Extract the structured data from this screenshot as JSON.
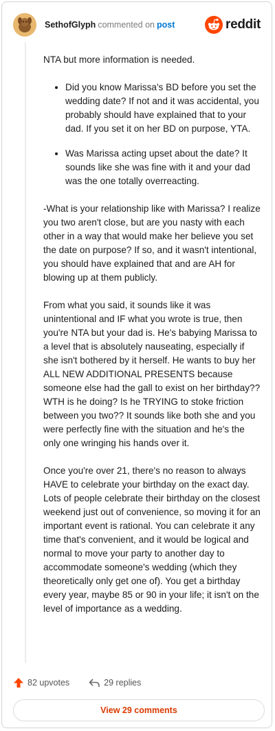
{
  "header": {
    "username": "SethofGlyph",
    "action": "commented on",
    "target": "post",
    "brand": "reddit"
  },
  "comment": {
    "intro": "NTA but more information is needed.",
    "bullets": [
      "Did you know Marissa's BD before you set the wedding date? If not and it was accidental, you probably should have explained that to your dad. If you set it on her BD on purpose, YTA.",
      "Was Marissa acting upset about the date? It sounds like she was fine with it and your dad was the one totally overreacting."
    ],
    "paragraphs": [
      "-What is your relationship like with Marissa? I realize you two aren't close, but are you nasty with each other in a way that would make her believe you set the date on purpose? If so, and it wasn't intentional, you should have explained that and are AH for blowing up at them publicly.",
      "From what you said, it sounds like it was unintentional and IF what you wrote is true, then you're NTA but your dad is. He's babying Marissa to a level that is absolutely nauseating, especially if she isn't bothered by it herself. He wants to buy her ALL NEW ADDITIONAL PRESENTS because someone else had the gall to exist on her birthday?? WTH is he doing? Is he TRYING to stoke friction between you two?? It sounds like both she and you were perfectly fine with the situation and he's the only one wringing his hands over it.",
      "Once you're over 21, there's no reason to always HAVE to celebrate your birthday on the exact day. Lots of people celebrate their birthday on the closest weekend just out of convenience, so moving it for an important event is rational. You can celebrate it any time that's convenient, and it would be logical and normal to move your party to another day to accommodate someone's wedding (which they theoretically only get one of). You get a birthday every year, maybe 85 or 90 in your life; it isn't on the level of importance as a wedding."
    ]
  },
  "actions": {
    "upvotes": "82 upvotes",
    "replies": "29 replies"
  },
  "footer": {
    "view_comments": "View 29 comments"
  },
  "colors": {
    "upvote": "#ff4500",
    "link": "#0079d3",
    "view_button_text": "#d93a00"
  },
  "icons": [
    "avatar",
    "reddit-logo-icon",
    "upvote-arrow-icon",
    "reply-arrow-icon"
  ]
}
